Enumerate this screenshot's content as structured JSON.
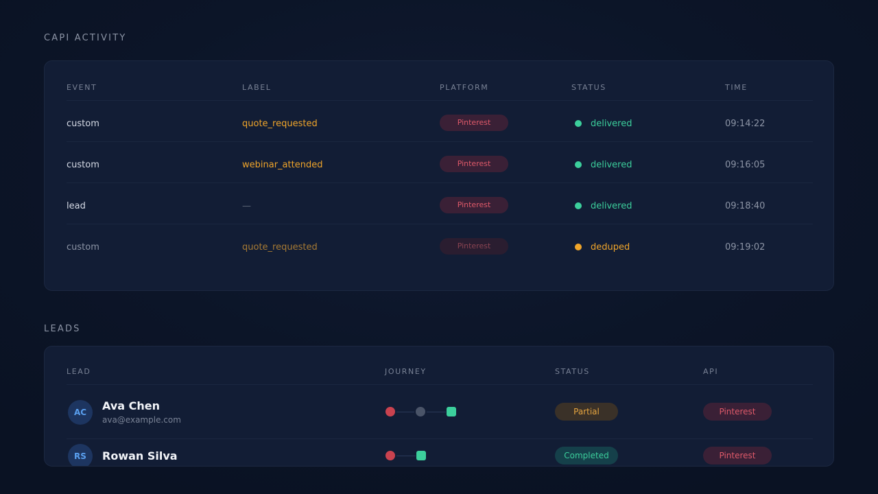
{
  "activity": {
    "title": "CAPI ACTIVITY",
    "headers": {
      "event": "EVENT",
      "label": "LABEL",
      "platform": "PLATFORM",
      "status": "STATUS",
      "time": "TIME"
    },
    "rows": [
      {
        "event": "custom",
        "label": "quote_requested",
        "platform": "Pinterest",
        "status": "delivered",
        "time": "09:14:22",
        "status_color": "#3ccf9c"
      },
      {
        "event": "custom",
        "label": "webinar_attended",
        "platform": "Pinterest",
        "status": "delivered",
        "time": "09:16:05",
        "status_color": "#3ccf9c"
      },
      {
        "event": "lead",
        "label": "—",
        "platform": "Pinterest",
        "status": "delivered",
        "time": "09:18:40",
        "status_color": "#3ccf9c"
      },
      {
        "event": "custom",
        "label": "quote_requested",
        "platform": "Pinterest",
        "status": "deduped",
        "time": "09:19:02",
        "status_color": "#f0a52a"
      }
    ]
  },
  "leads": {
    "title": "LEADS",
    "headers": {
      "lead": "LEAD",
      "journey": "JOURNEY",
      "status": "STATUS",
      "api": "API"
    },
    "rows": [
      {
        "initials": "AC",
        "name": "Ava Chen",
        "email": "ava@example.com",
        "status": "Partial",
        "api": "Pinterest"
      },
      {
        "initials": "RS",
        "name": "Rowan Silva",
        "email": "",
        "status": "Completed",
        "api": "Pinterest"
      }
    ]
  },
  "colors": {
    "delivered": "#3ccf9c",
    "deduped": "#f0a52a",
    "pinterest": "#e05a6a",
    "journey_red": "#c9424f",
    "journey_gray": "#4a5468",
    "journey_green": "#3ccf9c"
  }
}
